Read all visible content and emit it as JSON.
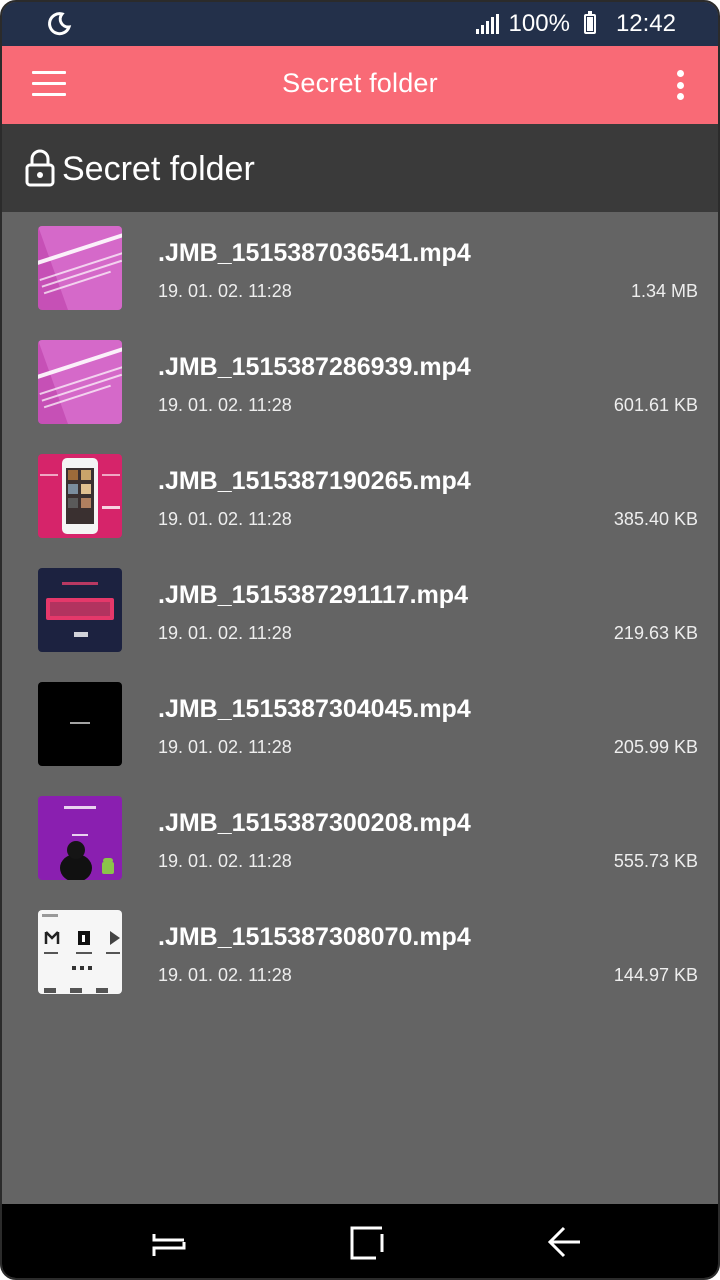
{
  "status_bar": {
    "battery_percent": "100%",
    "time": "12:42",
    "icons": [
      "moon-icon",
      "signal-icon",
      "battery-icon"
    ]
  },
  "app_bar": {
    "title": "Secret folder",
    "menu_icon": "hamburger-icon",
    "overflow_icon": "more-vert-icon",
    "color": "#f96a76"
  },
  "folder_header": {
    "title": "Secret folder",
    "icon": "lock-icon"
  },
  "files": [
    {
      "name": ".JMB_1515387036541.mp4",
      "date": "19. 01. 02. 11:28",
      "size": "1.34 MB",
      "thumb": "pink-instagram"
    },
    {
      "name": ".JMB_1515387286939.mp4",
      "date": "19. 01. 02. 11:28",
      "size": "601.61 KB",
      "thumb": "pink-instagram"
    },
    {
      "name": ".JMB_1515387190265.mp4",
      "date": "19. 01. 02. 11:28",
      "size": "385.40 KB",
      "thumb": "pink-downloader"
    },
    {
      "name": ".JMB_1515387291117.mp4",
      "date": "19. 01. 02. 11:28",
      "size": "219.63 KB",
      "thumb": "navy-2018"
    },
    {
      "name": ".JMB_1515387304045.mp4",
      "date": "19. 01. 02. 11:28",
      "size": "205.99 KB",
      "thumb": "black"
    },
    {
      "name": ".JMB_1515387300208.mp4",
      "date": "19. 01. 02. 11:28",
      "size": "555.73 KB",
      "thumb": "purple-android"
    },
    {
      "name": ".JMB_1515387308070.mp4",
      "date": "19. 01. 02. 11:28",
      "size": "144.97 KB",
      "thumb": "white-apps"
    }
  ],
  "nav_bar": {
    "icons": [
      "recent-apps-icon",
      "home-icon",
      "back-icon"
    ]
  },
  "colors": {
    "background": "#646464",
    "header": "#3a3a3a",
    "status_bar": "#23304a"
  }
}
